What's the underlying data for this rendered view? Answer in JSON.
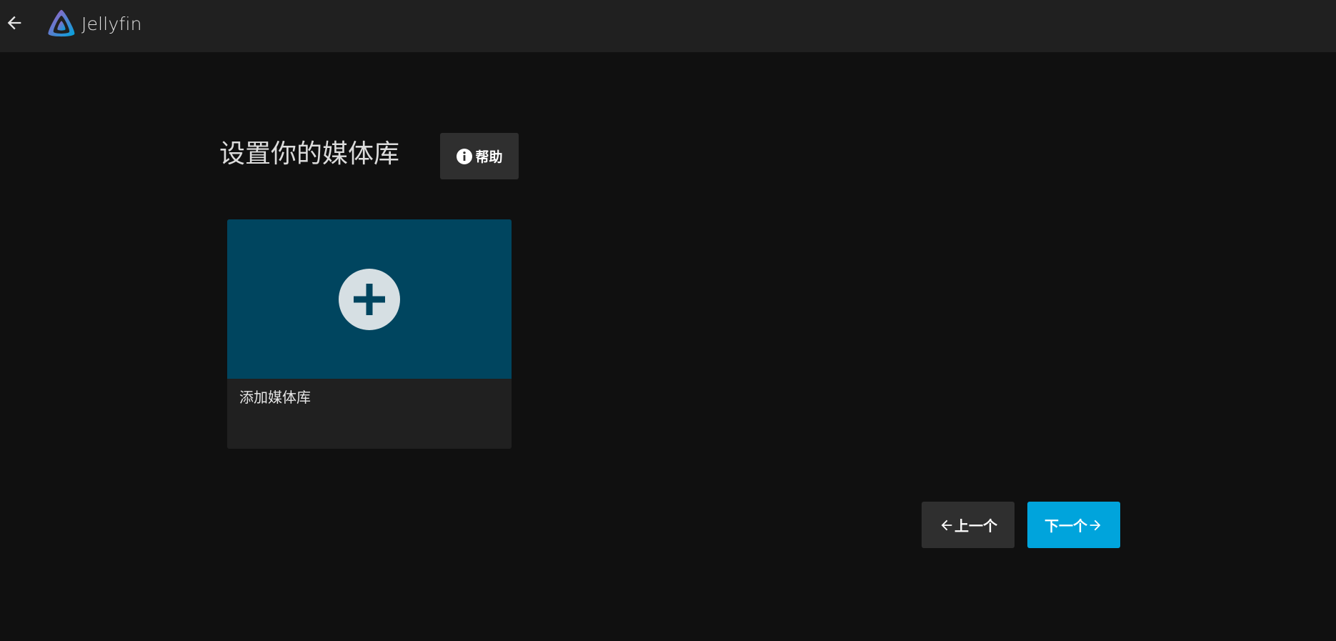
{
  "header": {
    "back_icon": "arrow-left-icon",
    "logo_icon": "jellyfin-logo-icon",
    "app_name": "Jellyfin"
  },
  "main": {
    "title": "设置你的媒体库",
    "help_button": {
      "icon": "info-icon",
      "label": "帮助"
    },
    "add_library_card": {
      "icon": "add-circle-icon",
      "label": "添加媒体库"
    },
    "previous_button": {
      "icon": "arrow-left-icon",
      "label": "上一个"
    },
    "next_button": {
      "icon": "arrow-right-icon",
      "label": "下一个"
    }
  },
  "colors": {
    "background": "#101010",
    "header": "#202020",
    "card_image": "#00455f",
    "accent": "#00a4dc",
    "secondary_button": "#2f2f2f"
  }
}
